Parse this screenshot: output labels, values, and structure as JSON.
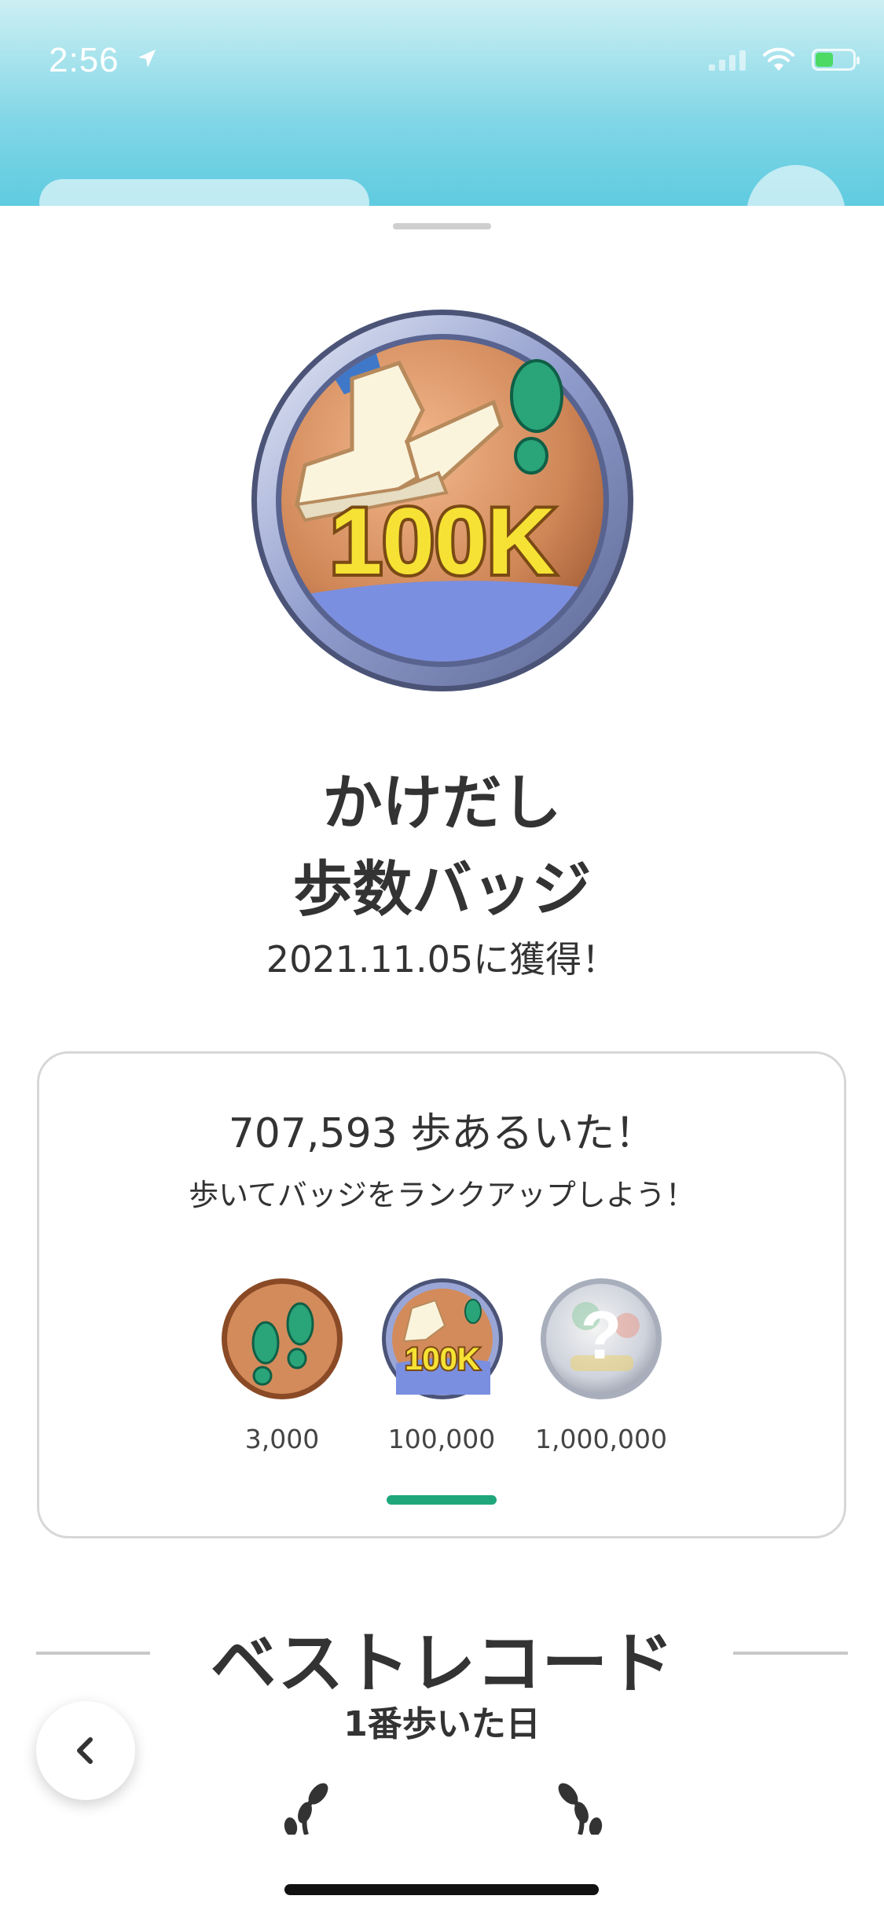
{
  "status_bar": {
    "time": "2:56"
  },
  "badge": {
    "title_line1": "かけだし",
    "title_line2": "歩数バッジ",
    "acquired": "2021.11.05に獲得！",
    "emblem_text": "100K"
  },
  "progress_card": {
    "steps_text": "707,593 歩あるいた！",
    "hint": "歩いてバッジをランクアップしよう！",
    "tiers": [
      {
        "label": "3,000",
        "icon": "footprints-badge-icon"
      },
      {
        "label": "100,000",
        "icon": "100k-badge-icon",
        "emblem_text": "100K"
      },
      {
        "label": "1,000,000",
        "icon": "locked-badge-icon",
        "emblem_text": "?"
      }
    ]
  },
  "best_record": {
    "title": "ベストレコード",
    "subtitle": "1番歩いた日"
  },
  "colors": {
    "accent": "#1fa67a",
    "header_sky": "#7fd6e6",
    "bronze": "#d38b5d",
    "silver_ring": "#8a96c8"
  }
}
